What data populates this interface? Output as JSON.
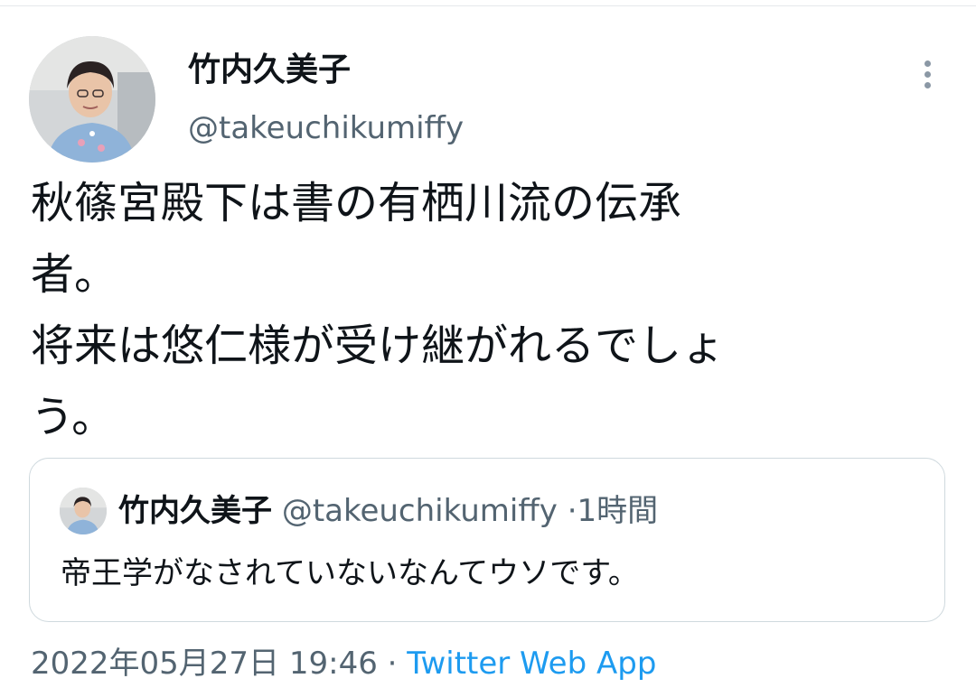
{
  "tweet": {
    "author": {
      "display_name": "竹内久美子",
      "handle": "@takeuchikumiffy",
      "avatar_icon": "profile-photo"
    },
    "text": "秋篠宮殿下は書の有栖川流の伝承\n者。\n将来は悠仁様が受け継がれるでしょ\nう。",
    "timestamp": "2022年05月27日 19:46",
    "separator": "·",
    "source": "Twitter Web App",
    "more_icon": "more-vertical-icon"
  },
  "quote": {
    "display_name": "竹内久美子",
    "handle": "@takeuchikumiffy",
    "separator": "·",
    "time": "1時間",
    "text": "帝王学がなされていないなんてウソです。"
  },
  "colors": {
    "text_primary": "#0f1419",
    "text_secondary": "#536471",
    "link": "#1d9bf0",
    "border": "#cfd9de"
  }
}
